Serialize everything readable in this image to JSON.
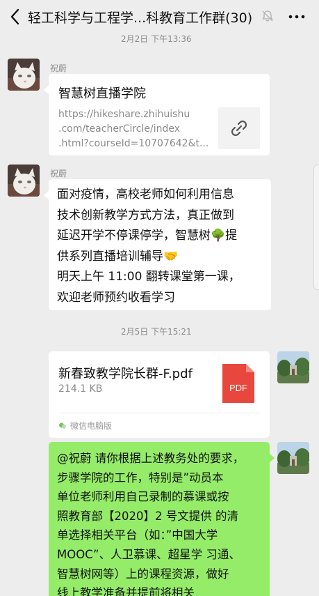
{
  "header": {
    "title": "轻工科学与工程学...科教育工作群(30)",
    "back_icon": "chevron-left-icon",
    "mute_icon": "bell-off-icon",
    "more_icon": "more-dots-icon"
  },
  "messages": [
    {
      "timestamp": "2月2日 下午13:36",
      "sender": "祝蔚",
      "type": "link",
      "title": "智慧树直播学院",
      "url_lines": [
        "https://hikeshare.zhihuishu",
        ".com/teacherCircle/index",
        ".html?courseId=10707642&t..."
      ],
      "thumb_icon": "link-chain-icon"
    },
    {
      "sender": "祝蔚",
      "type": "text",
      "lines": [
        "面对疫情，高校老师如何利用信息",
        "技术创新教学方式方法，真正做到",
        "延迟开学不停课停学，智慧树🌳提",
        "供系列直播培训辅导🤝",
        "明天上午 11:00 翻转课堂第一课，",
        "欢迎老师预约收看学习"
      ]
    },
    {
      "timestamp": "2月5日 下午15:21",
      "type": "file",
      "file_name": "新春致教学院长群-F.pdf",
      "file_size": "214.1 KB",
      "file_badge": "PDF",
      "source": "微信电脑版"
    },
    {
      "type": "text-self",
      "lines": [
        "@祝蔚 请你根据上述教务处的要求，",
        "步骤学院的工作，特别是”动员本",
        "单位老师利用自己录制的慕课或按",
        "照教育部【2020】2 号文提供 的清",
        "单选择相关平台（如：”中国大学",
        "MOOC”、人卫慕课、超星学 习通、",
        "智慧树网等）上的课程资源，做好",
        "线上教学准备并提前将相关"
      ]
    }
  ],
  "colors": {
    "background": "#ededed",
    "self_bubble": "#95ec69",
    "pdf_red": "#e8473d"
  }
}
